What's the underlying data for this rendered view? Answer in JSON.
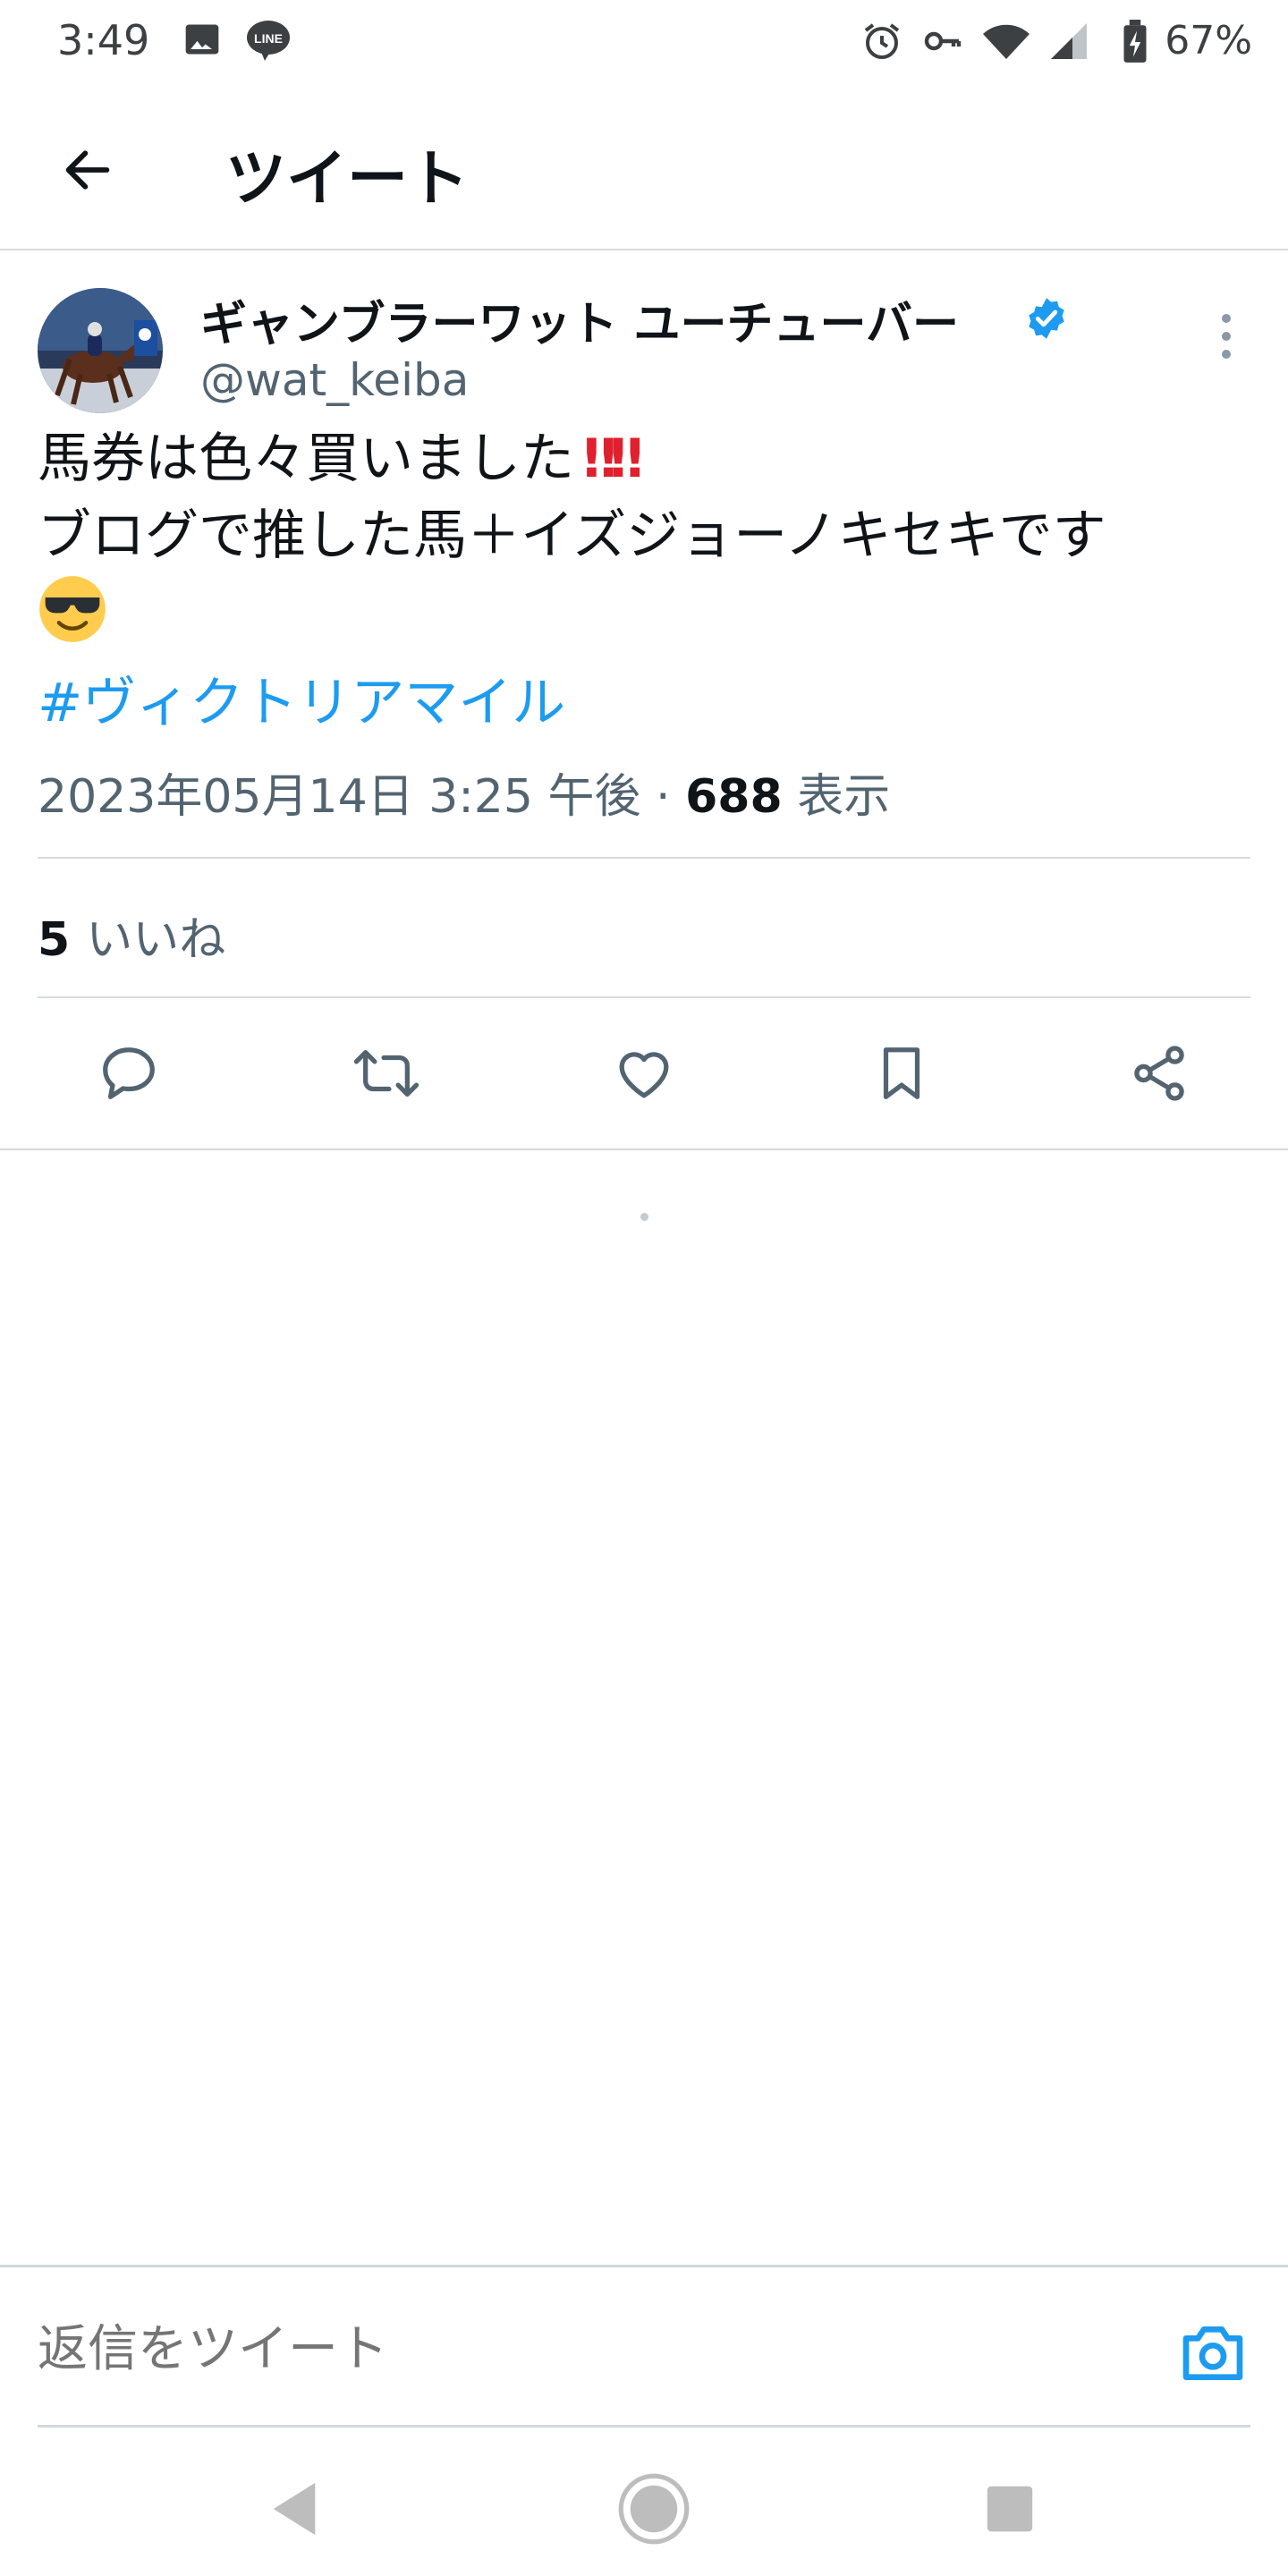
{
  "status_bar": {
    "time": "3:49",
    "battery": "67%",
    "icons": [
      "image-icon",
      "line-app-icon",
      "alarm-icon",
      "vpn-key-icon",
      "wifi-icon",
      "signal-icon",
      "battery-charging-icon"
    ]
  },
  "header": {
    "title": "ツイート",
    "back_icon": "arrow-left-icon"
  },
  "tweet": {
    "author_name": "ギャンブラーワット ユーチューバー",
    "handle": "@wat_keiba",
    "verified": true,
    "text_line1": "馬券は色々買いました",
    "text_line1_marks": "‼‼",
    "text_line2": "ブログで推した馬＋イズジョーノキセキです",
    "emoji": "smiling-face-with-sunglasses",
    "hashtag": "#ヴィクトリアマイル",
    "timestamp": "2023年05月14日 3:25 午後",
    "separator": " · ",
    "views_count": "688",
    "views_label": "表示",
    "likes_count": "5",
    "likes_label": "いいね"
  },
  "actions": [
    {
      "name": "reply",
      "icon": "reply-bubble-icon"
    },
    {
      "name": "retweet",
      "icon": "retweet-icon"
    },
    {
      "name": "like",
      "icon": "heart-icon"
    },
    {
      "name": "bookmark",
      "icon": "bookmark-icon"
    },
    {
      "name": "share",
      "icon": "share-icon"
    }
  ],
  "reply": {
    "placeholder": "返信をツイート"
  },
  "colors": {
    "accent": "#1d9bf0",
    "text_primary": "#0f1419",
    "text_secondary": "#536471",
    "divider": "#d5dbe0",
    "alert_red": "#e0202e"
  }
}
